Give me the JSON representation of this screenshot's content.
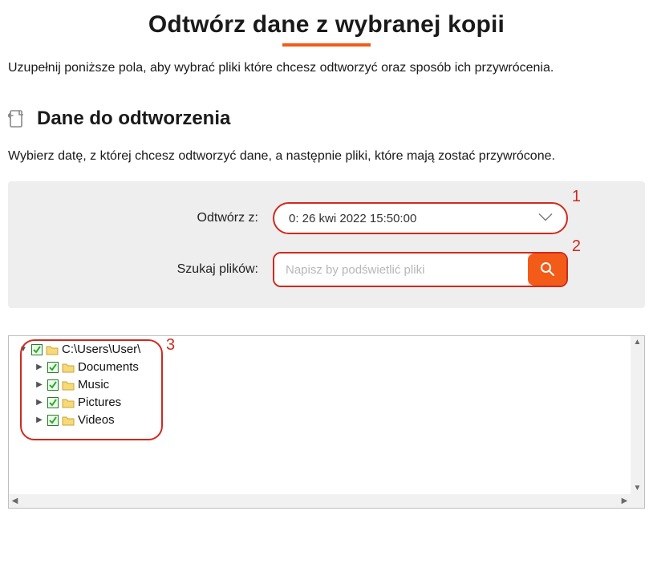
{
  "title": "Odtwórz dane z wybranej kopii",
  "instructions": "Uzupełnij poniższe pola, aby wybrać pliki które chcesz odtworzyć oraz sposób ich przywrócenia.",
  "section_title": "Dane do odtworzenia",
  "subinstructions": "Wybierz datę, z której chcesz odtworzyć dane, a następnie pliki, które mają zostać przywrócone.",
  "form": {
    "restore_from_label": "Odtwórz z:",
    "restore_from_value": "0: 26 kwi 2022 15:50:00",
    "search_label": "Szukaj plików:",
    "search_placeholder": "Napisz by podświetlić pliki"
  },
  "annotations": {
    "a1": "1",
    "a2": "2",
    "a3": "3"
  },
  "tree": {
    "root": {
      "label": "C:\\Users\\User\\",
      "expanded": true,
      "checked": true,
      "children": [
        {
          "label": "Documents",
          "checked": true
        },
        {
          "label": "Music",
          "checked": true
        },
        {
          "label": "Pictures",
          "checked": true
        },
        {
          "label": "Videos",
          "checked": true
        }
      ]
    }
  },
  "colors": {
    "accent": "#f35b18",
    "annotation": "#cf2a1d"
  }
}
